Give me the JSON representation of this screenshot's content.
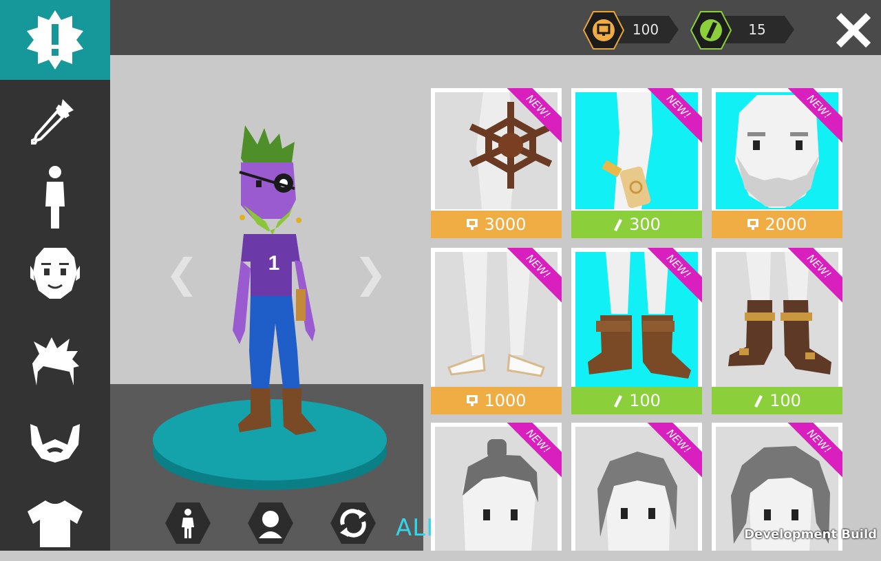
{
  "currency": {
    "coins": {
      "icon": "coin-screen-icon",
      "value": "100"
    },
    "gems": {
      "icon": "green-gem-icon",
      "value": "15"
    }
  },
  "sidebar": {
    "items": [
      {
        "name": "alert-badge-icon"
      },
      {
        "name": "eyedropper-icon"
      },
      {
        "name": "body-icon"
      },
      {
        "name": "face-icon"
      },
      {
        "name": "hair-icon"
      },
      {
        "name": "beard-icon"
      },
      {
        "name": "shirt-icon"
      }
    ]
  },
  "character": {
    "jersey_number": "1"
  },
  "shop": {
    "new_label": "NEW!",
    "items": [
      {
        "item": "ship-wheel",
        "price": "3000",
        "currency": "coins",
        "new": true
      },
      {
        "item": "scroll",
        "price": "300",
        "currency": "gems",
        "new": true
      },
      {
        "item": "beard",
        "price": "2000",
        "currency": "coins",
        "new": true
      },
      {
        "item": "sandals",
        "price": "1000",
        "currency": "coins",
        "new": true
      },
      {
        "item": "pirate-boots",
        "price": "100",
        "currency": "gems",
        "new": true
      },
      {
        "item": "buckle-boots",
        "price": "100",
        "currency": "gems",
        "new": true
      },
      {
        "item": "topknot-hair",
        "price": "",
        "currency": "",
        "new": true
      },
      {
        "item": "bob-hair",
        "price": "",
        "currency": "",
        "new": true
      },
      {
        "item": "curly-hair",
        "price": "",
        "currency": "",
        "new": true
      }
    ]
  },
  "controls": [
    "full-body-view-icon",
    "head-view-icon",
    "rotate-icon"
  ],
  "watermarks": {
    "alpha": "ALPHA",
    "dev": "Development Build"
  },
  "colors": {
    "accent": "#16989a",
    "new": "#d91fbe",
    "coin_price": "#f0ad43",
    "gem_price": "#8bcf3a",
    "cyan_bg": "#10f0f5"
  }
}
